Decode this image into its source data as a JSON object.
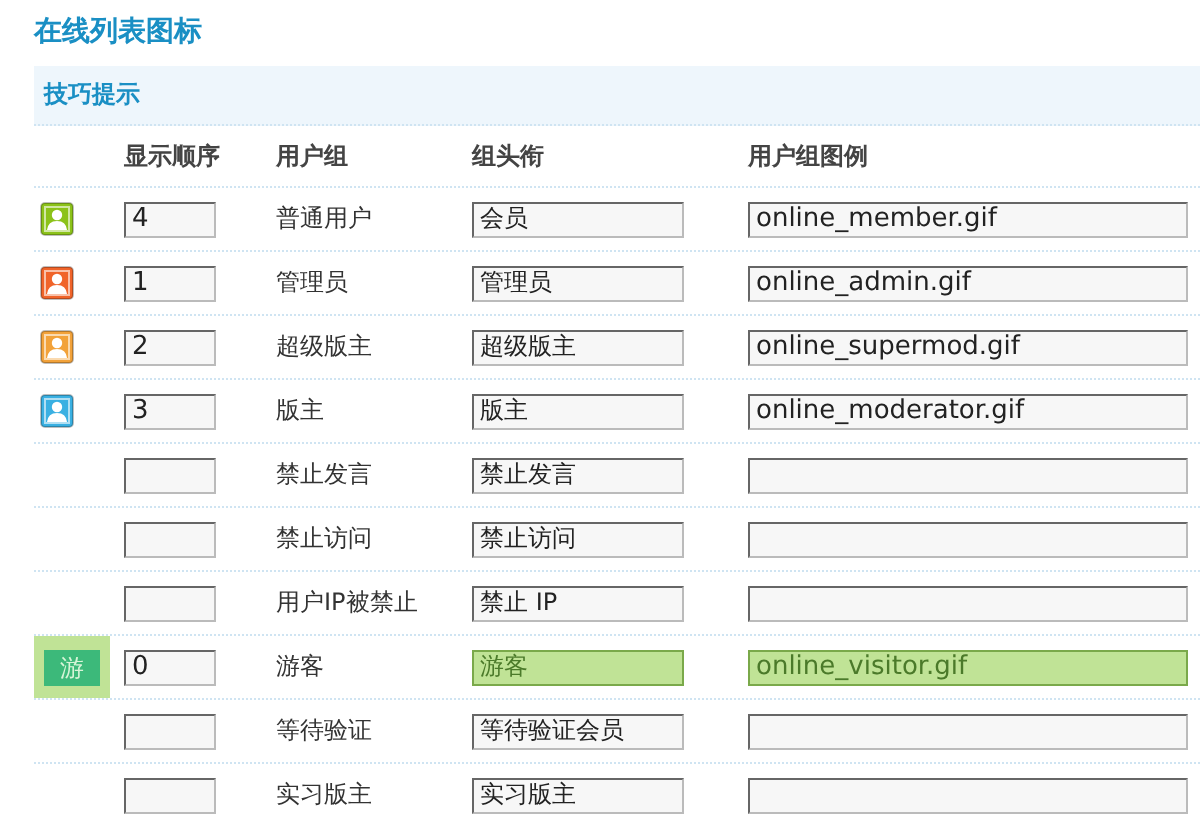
{
  "title": "在线列表图标",
  "tip": "技巧提示",
  "columns": [
    "显示顺序",
    "用户组",
    "组头衔",
    "用户组图例"
  ],
  "rows": [
    {
      "icon": {
        "kind": "person",
        "color": "#8cc21a"
      },
      "order": "4",
      "group": "普通用户",
      "rank": "会员",
      "image": "online_member.gif",
      "highlighted": false
    },
    {
      "icon": {
        "kind": "person",
        "color": "#f0642a"
      },
      "order": "1",
      "group": "管理员",
      "rank": "管理员",
      "image": "online_admin.gif",
      "highlighted": false
    },
    {
      "icon": {
        "kind": "person",
        "color": "#f2a23a"
      },
      "order": "2",
      "group": "超级版主",
      "rank": "超级版主",
      "image": "online_supermod.gif",
      "highlighted": false
    },
    {
      "icon": {
        "kind": "person",
        "color": "#3ab0e2"
      },
      "order": "3",
      "group": "版主",
      "rank": "版主",
      "image": "online_moderator.gif",
      "highlighted": false
    },
    {
      "group": "禁止发言",
      "rank": "禁止发言",
      "highlighted": false
    },
    {
      "group": "禁止访问",
      "rank": "禁止访问",
      "highlighted": false
    },
    {
      "group": "用户IP被禁止",
      "rank": "禁止 IP",
      "highlighted": false
    },
    {
      "icon": {
        "kind": "badge",
        "color": "#3cb97a",
        "label": "游"
      },
      "order": "0",
      "group": "游客",
      "rank": "游客",
      "image": "online_visitor.gif",
      "highlighted": true
    },
    {
      "group": "等待验证",
      "rank": "等待验证会员",
      "highlighted": false
    },
    {
      "group": "实习版主",
      "rank": "实习版主",
      "highlighted": false
    }
  ]
}
